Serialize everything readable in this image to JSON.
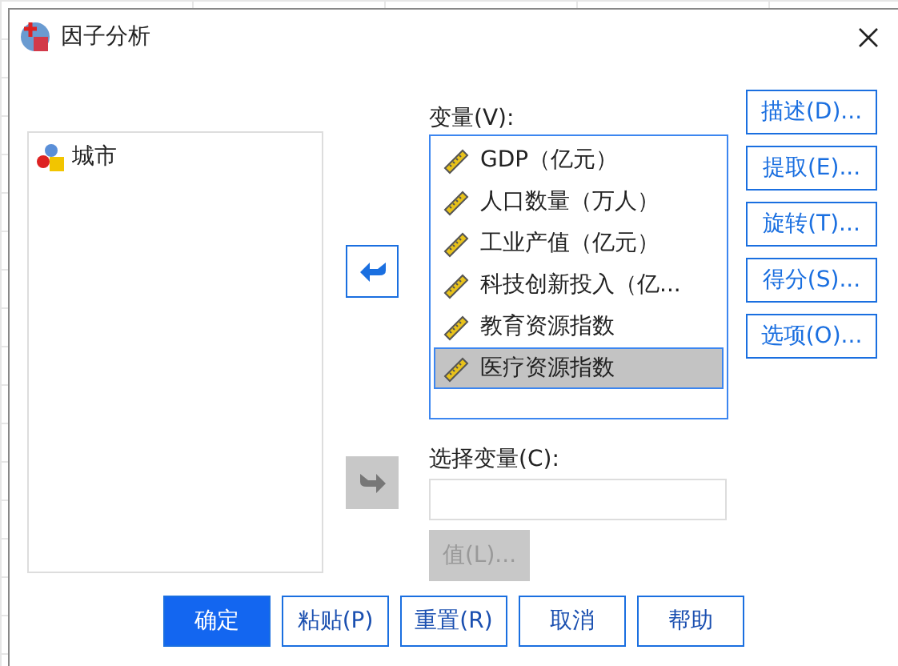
{
  "window": {
    "title": "因子分析"
  },
  "source_list": {
    "items": [
      {
        "label": "城市"
      }
    ]
  },
  "move_in_button": {
    "disabled": false
  },
  "variables": {
    "label": "变量(V):",
    "items": [
      {
        "label": "GDP（亿元）",
        "selected": false
      },
      {
        "label": "人口数量（万人）",
        "selected": false
      },
      {
        "label": "工业产值（亿元）",
        "selected": false
      },
      {
        "label": "科技创新投入（亿...",
        "selected": false
      },
      {
        "label": "教育资源指数",
        "selected": false
      },
      {
        "label": "医疗资源指数",
        "selected": true
      }
    ]
  },
  "side_buttons": [
    "描述(D)...",
    "提取(E)...",
    "旋转(T)...",
    "得分(S)...",
    "选项(O)..."
  ],
  "move_select_button": {
    "disabled": true
  },
  "selection_variable": {
    "label": "选择变量(C):"
  },
  "value_button": {
    "label": "值(L)...",
    "disabled": true
  },
  "buttons": [
    {
      "label": "确定",
      "primary": true
    },
    {
      "label": "粘贴(P)",
      "primary": false
    },
    {
      "label": "重置(R)",
      "primary": false
    },
    {
      "label": "取消",
      "primary": false
    },
    {
      "label": "帮助",
      "primary": false
    }
  ]
}
